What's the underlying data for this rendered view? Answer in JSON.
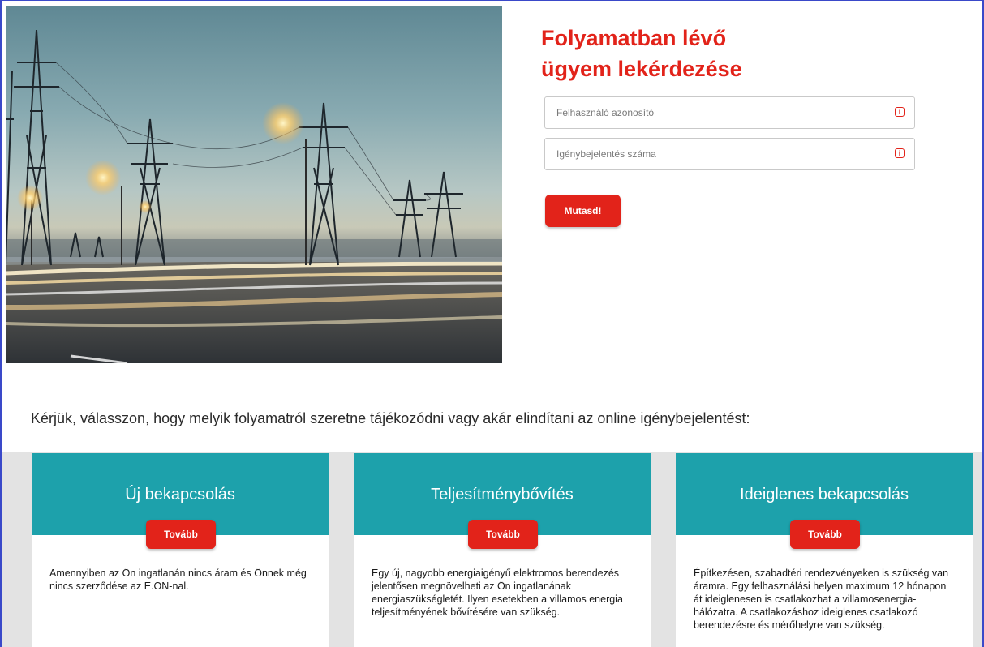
{
  "form": {
    "title_line1": "Folyamatban lévő",
    "title_line2": "ügyem lekérdezése",
    "user_id_placeholder": "Felhasználó azonosító",
    "request_number_placeholder": "Igénybejelentés száma",
    "submit_label": "Mutasd!"
  },
  "prompt": "Kérjük, válasszon, hogy melyik folyamatról szeretne tájékozódni vagy akár elindítani az online igénybejelentést:",
  "cards": [
    {
      "title": "Új bekapcsolás",
      "button": "Tovább",
      "text": "Amennyiben az Ön ingatlanán nincs áram és Önnek még nincs szerződése az E.ON-nal."
    },
    {
      "title": "Teljesítménybővítés",
      "button": "Tovább",
      "text": "Egy új, nagyobb energiaigényű elektromos berendezés jelentősen megnövelheti az Ön ingatlanának energiaszükségletét. Ilyen esetekben a villamos energia teljesítményének bővítésére van szükség."
    },
    {
      "title": "Ideiglenes bekapcsolás",
      "button": "Tovább",
      "text": "Építkezésen, szabadtéri rendezvényeken is szükség van áramra. Egy felhasználási helyen maximum 12 hónapon át ideiglenesen is csatlakozhat a villamosenergia-hálózatra. A csatlakozáshoz ideiglenes csatlakozó berendezésre és mérőhelyre van szükség."
    }
  ],
  "icons": {
    "info": "info-icon"
  },
  "colors": {
    "accent_red": "#e2231a",
    "teal": "#1da1ab",
    "band_gray": "#e3e3e3"
  }
}
